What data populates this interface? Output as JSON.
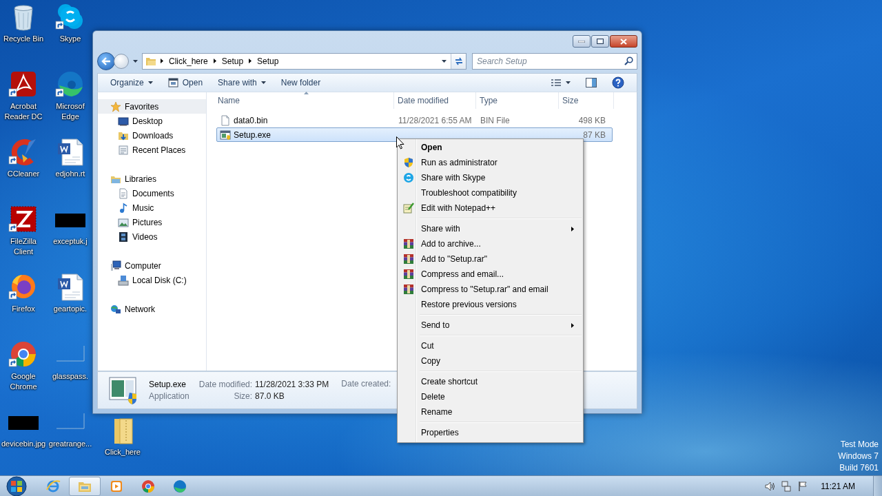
{
  "desktop_icons": [
    {
      "label": "Recycle Bin",
      "kind": "recycle",
      "shortcut": false
    },
    {
      "label": "Acrobat Reader DC",
      "kind": "acrobat",
      "shortcut": true
    },
    {
      "label": "CCleaner",
      "kind": "ccleaner",
      "shortcut": true
    },
    {
      "label": "FileZilla Client",
      "kind": "filezilla",
      "shortcut": true
    },
    {
      "label": "Firefox",
      "kind": "firefox",
      "shortcut": true
    },
    {
      "label": "Google Chrome",
      "kind": "chrome",
      "shortcut": true
    },
    {
      "label": "devicebin.jpg",
      "kind": "image-dark",
      "shortcut": false
    },
    {
      "label": "Skype",
      "kind": "skype",
      "shortcut": true
    },
    {
      "label": "Microsof Edge",
      "kind": "edge",
      "shortcut": true
    },
    {
      "label": "edjohn.rt",
      "kind": "word",
      "shortcut": false
    },
    {
      "label": "exceptuk.j",
      "kind": "image-dark",
      "shortcut": false
    },
    {
      "label": "geartopic.",
      "kind": "word",
      "shortcut": false
    },
    {
      "label": "glasspass.",
      "kind": "image-blank",
      "shortcut": false
    },
    {
      "label": "greatrange...",
      "kind": "image-blank",
      "shortcut": false
    },
    {
      "label": "Click_here",
      "kind": "folder",
      "shortcut": false
    }
  ],
  "window": {
    "address": {
      "crumbs": [
        "Click_here",
        "Setup",
        "Setup"
      ]
    },
    "search": {
      "placeholder": "Search Setup"
    },
    "toolbar": [
      {
        "label": "Organize",
        "kind": "menu"
      },
      {
        "label": "Open",
        "kind": "icon"
      },
      {
        "label": "Share with",
        "kind": "menu"
      },
      {
        "label": "New folder",
        "kind": "plain"
      }
    ],
    "nav_pane": [
      {
        "label": "Favorites",
        "kind": "star",
        "selected": true,
        "children": [
          {
            "label": "Desktop",
            "kind": "desktop",
            "selected": false
          },
          {
            "label": "Downloads",
            "kind": "downloads",
            "selected": false
          },
          {
            "label": "Recent Places",
            "kind": "recent",
            "selected": false
          }
        ]
      },
      {
        "label": "Libraries",
        "kind": "library",
        "selected": false,
        "children": [
          {
            "label": "Documents",
            "kind": "documents",
            "selected": false
          },
          {
            "label": "Music",
            "kind": "music",
            "selected": false
          },
          {
            "label": "Pictures",
            "kind": "pictures",
            "selected": false
          },
          {
            "label": "Videos",
            "kind": "videos",
            "selected": false
          }
        ]
      },
      {
        "label": "Computer",
        "kind": "computer",
        "selected": false,
        "children": [
          {
            "label": "Local Disk (C:)",
            "kind": "disk",
            "selected": false
          }
        ]
      },
      {
        "label": "Network",
        "kind": "network",
        "selected": false
      }
    ],
    "columns": [
      {
        "label": "Name",
        "sorted": true
      },
      {
        "label": "Date modified",
        "sorted": false
      },
      {
        "label": "Type",
        "sorted": false
      },
      {
        "label": "Size",
        "sorted": false
      }
    ],
    "files": [
      {
        "name": "data0.bin",
        "kind": "file",
        "date": "11/28/2021 6:55 AM",
        "type": "BIN File",
        "size": "498 KB",
        "selected": false
      },
      {
        "name": "Setup.exe",
        "kind": "exe",
        "size": "87 KB",
        "selected": true
      }
    ],
    "details": {
      "name": "Setup.exe",
      "type": "Application",
      "columns": [
        [
          {
            "label": "Date modified:",
            "value": "11/28/2021 3:33 PM"
          },
          {
            "label": "Size:",
            "value": "87.0 KB"
          }
        ],
        [
          {
            "label": "Date created:"
          }
        ]
      ]
    }
  },
  "context_menu": {
    "items": [
      {
        "kind": "plain",
        "label": "Open",
        "default": true,
        "submenu": false
      },
      {
        "kind": "shield",
        "label": "Run as administrator",
        "default": false,
        "submenu": false
      },
      {
        "kind": "skype",
        "label": "Share with Skype",
        "default": false,
        "submenu": false
      },
      {
        "kind": "plain",
        "label": "Troubleshoot compatibility",
        "default": false,
        "submenu": false
      },
      {
        "kind": "notepad",
        "label": "Edit with Notepad++",
        "default": false,
        "submenu": false
      },
      {
        "kind": "separator"
      },
      {
        "kind": "plain",
        "label": "Share with",
        "default": false,
        "submenu": true
      },
      {
        "kind": "archive",
        "label": "Add to archive...",
        "default": false,
        "submenu": false
      },
      {
        "kind": "archive",
        "label": "Add to \"Setup.rar\"",
        "default": false,
        "submenu": false
      },
      {
        "kind": "archive",
        "label": "Compress and email...",
        "default": false,
        "submenu": false
      },
      {
        "kind": "archive",
        "label": "Compress to \"Setup.rar\" and email",
        "default": false,
        "submenu": false
      },
      {
        "kind": "plain",
        "label": "Restore previous versions",
        "default": false,
        "submenu": false
      },
      {
        "kind": "separator"
      },
      {
        "kind": "plain",
        "label": "Send to",
        "default": false,
        "submenu": true
      },
      {
        "kind": "separator"
      },
      {
        "kind": "plain",
        "label": "Cut",
        "default": false,
        "submenu": false
      },
      {
        "kind": "plain",
        "label": "Copy",
        "default": false,
        "submenu": false
      },
      {
        "kind": "separator"
      },
      {
        "kind": "plain",
        "label": "Create shortcut",
        "default": false,
        "submenu": false
      },
      {
        "kind": "plain",
        "label": "Delete",
        "default": false,
        "submenu": false
      },
      {
        "kind": "plain",
        "label": "Rename",
        "default": false,
        "submenu": false
      },
      {
        "kind": "separator"
      },
      {
        "kind": "plain",
        "label": "Properties",
        "default": false,
        "submenu": false
      }
    ]
  },
  "taskbar": {
    "apps": [
      {
        "kind": "ie",
        "selected": false
      },
      {
        "kind": "explorer",
        "selected": true
      },
      {
        "kind": "media",
        "selected": false
      },
      {
        "kind": "chrome",
        "selected": false
      },
      {
        "kind": "edge",
        "selected": false
      }
    ],
    "tray": [
      {
        "kind": "volume"
      },
      {
        "kind": "network"
      },
      {
        "kind": "flag"
      }
    ],
    "clock": "11:21 AM"
  },
  "os_notice": [
    "Test Mode",
    "Windows 7",
    "Build 7601"
  ]
}
